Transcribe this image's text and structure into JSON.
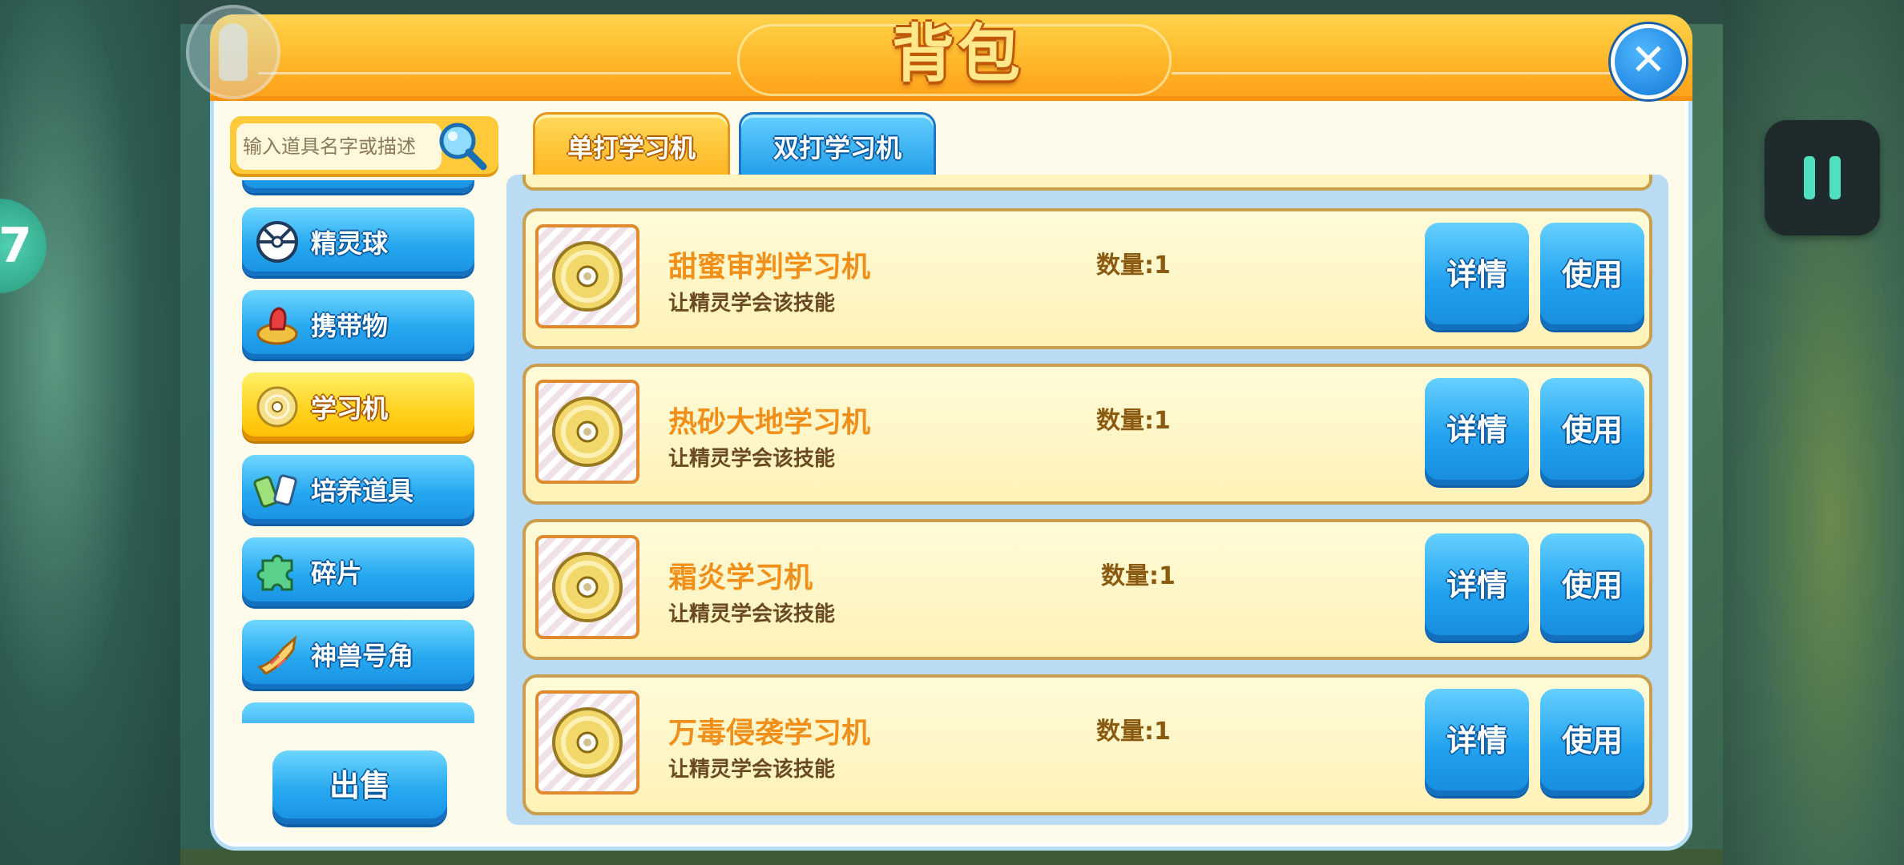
{
  "panel": {
    "title": "背包",
    "close_icon": "close-icon"
  },
  "search": {
    "placeholder": "输入道具名字或描述"
  },
  "nav": {
    "items": [
      {
        "label": "",
        "icon": "hidden-item-icon"
      },
      {
        "label": "精灵球",
        "icon": "pokeball-icon"
      },
      {
        "label": "携带物",
        "icon": "held-item-icon"
      },
      {
        "label": "学习机",
        "icon": "disc-icon",
        "active": true
      },
      {
        "label": "培养道具",
        "icon": "training-item-icon"
      },
      {
        "label": "碎片",
        "icon": "puzzle-piece-icon"
      },
      {
        "label": "神兽号角",
        "icon": "horn-icon"
      },
      {
        "label": "",
        "icon": "cutoff-item-icon"
      }
    ],
    "sell_label": "出售"
  },
  "tabs": [
    {
      "label": "单打学习机",
      "active": false
    },
    {
      "label": "双打学习机",
      "active": true
    }
  ],
  "items": [
    {
      "name": "甜蜜审判学习机",
      "desc": "让精灵学会该技能",
      "qty": "数量:1",
      "detail": "详情",
      "use": "使用"
    },
    {
      "name": "热砂大地学习机",
      "desc": "让精灵学会该技能",
      "qty": "数量:1",
      "detail": "详情",
      "use": "使用"
    },
    {
      "name": "霜炎学习机",
      "desc": "让精灵学会该技能",
      "qty": "数量:1",
      "detail": "详情",
      "use": "使用"
    },
    {
      "name": "万毒侵袭学习机",
      "desc": "让精灵学会该技能",
      "qty": "数量:1",
      "detail": "详情",
      "use": "使用"
    }
  ],
  "colors": {
    "accent_orange": "#ffb72a",
    "button_blue": "#22a2ee",
    "item_name": "#f0901a",
    "pause_icon": "#4fe0c0"
  }
}
